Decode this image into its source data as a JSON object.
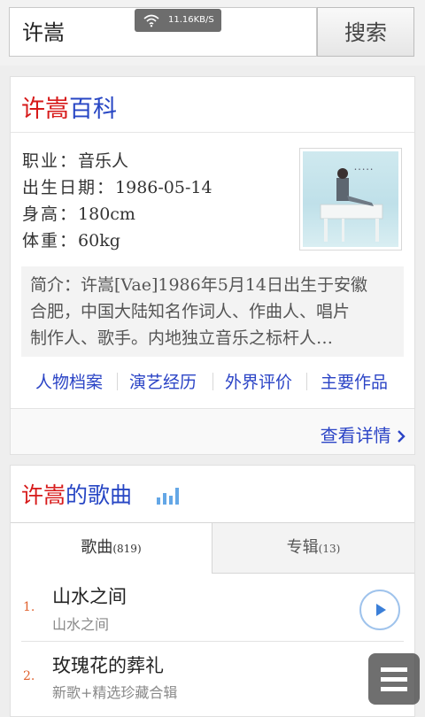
{
  "search": {
    "query": "许嵩",
    "button_label": "搜索",
    "status_speed": "11.16KB/S"
  },
  "baike": {
    "title_red": "许嵩",
    "title_blue": "百科",
    "info": [
      {
        "label": "职业：",
        "value": "音乐人"
      },
      {
        "label": "出生日期：",
        "value": "1986-05-14"
      },
      {
        "label": "身高：",
        "value": "180cm"
      },
      {
        "label": "体重：",
        "value": "60kg"
      }
    ],
    "intro_lines": [
      "简介：许嵩[Vae]1986年5月14日出生于安徽",
      "合肥，中国大陆知名作词人、作曲人、唱片",
      "制作人、歌手。内地独立音乐之标杆人…"
    ],
    "links": [
      "人物档案",
      "演艺经历",
      "外界评价",
      "主要作品"
    ],
    "detail_link": "查看详情"
  },
  "songs": {
    "title_red": "许嵩",
    "title_blue": "的歌曲",
    "tabs": [
      {
        "label": "歌曲",
        "count": "(819)"
      },
      {
        "label": "专辑",
        "count": "(13)"
      }
    ],
    "items": [
      {
        "num": "1.",
        "name": "山水之间",
        "album": "山水之间"
      },
      {
        "num": "2.",
        "name": "玫瑰花的葬礼",
        "album": "新歌+精选珍藏合辑"
      }
    ]
  },
  "colors": {
    "accent_red": "#d71a1a",
    "accent_blue": "#2746c4",
    "number_orange": "#e0622f"
  },
  "icons": [
    "wifi-icon",
    "bars-chart-icon",
    "play-icon",
    "chevron-right-icon",
    "menu-icon"
  ]
}
